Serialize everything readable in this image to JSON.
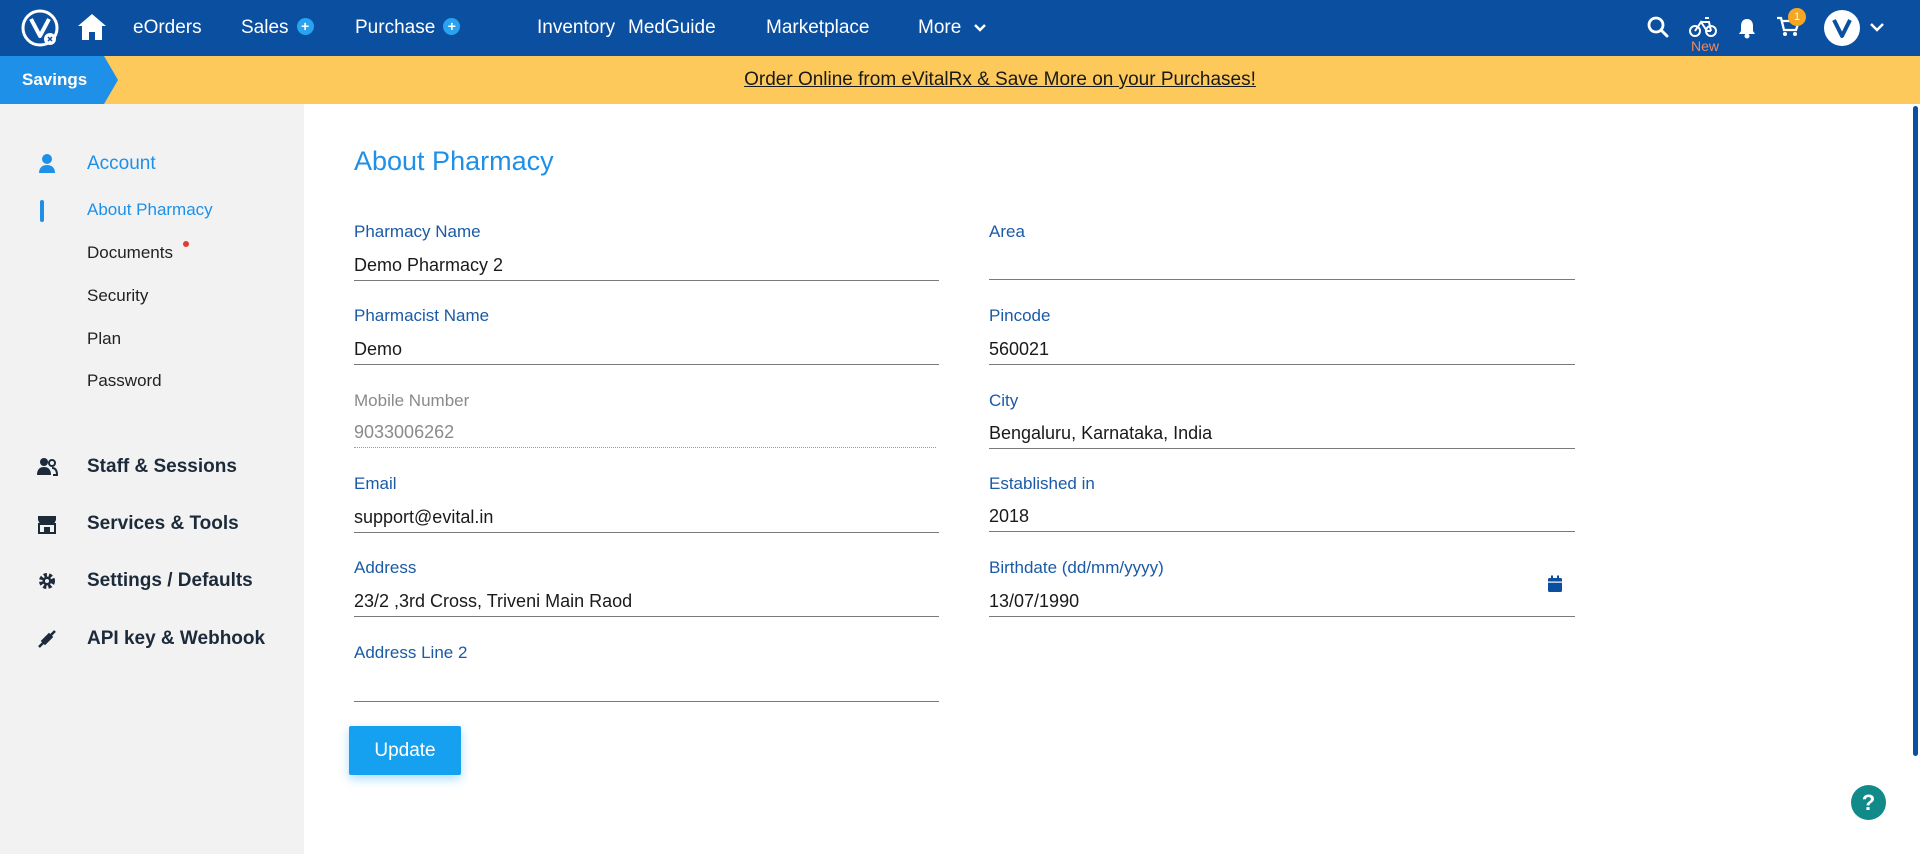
{
  "nav": {
    "items": [
      {
        "label": "eOrders",
        "has_plus": false
      },
      {
        "label": "Sales",
        "has_plus": true
      },
      {
        "label": "Purchase",
        "has_plus": true
      },
      {
        "label": "Inventory",
        "has_plus": false
      },
      {
        "label": "MedGuide",
        "has_plus": false
      },
      {
        "label": "Marketplace",
        "has_plus": false
      },
      {
        "label": "More",
        "has_plus": false
      }
    ],
    "plus_symbol": "+",
    "new_label": "New",
    "cart_count": "1",
    "icons": [
      "logo-icon",
      "home-icon",
      "search-icon",
      "bike-icon",
      "bell-icon",
      "cart-icon",
      "avatar",
      "chevron-down-icon"
    ]
  },
  "banner": {
    "tag": "Savings",
    "text": "Order Online from eVitalRx & Save More on your Purchases!"
  },
  "sidebar": {
    "account": "Account",
    "subitems": [
      "About Pharmacy",
      "Documents",
      "Security",
      "Plan",
      "Password"
    ],
    "staff": "Staff & Sessions",
    "services": "Services & Tools",
    "settings": "Settings / Defaults",
    "api": "API key & Webhook"
  },
  "main": {
    "title": "About Pharmacy",
    "fields": {
      "pharmacy_name": {
        "label": "Pharmacy Name",
        "value": "Demo Pharmacy 2"
      },
      "pharmacist_name": {
        "label": "Pharmacist Name",
        "value": "Demo"
      },
      "mobile": {
        "label": "Mobile Number",
        "value": "9033006262"
      },
      "email": {
        "label": "Email",
        "value": "support@evital.in"
      },
      "address": {
        "label": "Address",
        "value": "23/2 ,3rd Cross, Triveni Main Raod"
      },
      "address2": {
        "label": "Address Line 2",
        "value": ""
      },
      "area": {
        "label": "Area",
        "value": ""
      },
      "pincode": {
        "label": "Pincode",
        "value": "560021"
      },
      "city": {
        "label": "City",
        "value": "Bengaluru, Karnataka, India"
      },
      "established": {
        "label": "Established in",
        "value": "2018"
      },
      "birthdate": {
        "label": "Birthdate (dd/mm/yyyy)",
        "value": "13/07/1990"
      }
    },
    "update_button": "Update"
  },
  "help": "?",
  "colors": {
    "nav_bg": "#0b4fa0",
    "banner_bg": "#fdc95b",
    "accent": "#1e90e8",
    "button": "#15a0f0",
    "help": "#128a8a"
  }
}
